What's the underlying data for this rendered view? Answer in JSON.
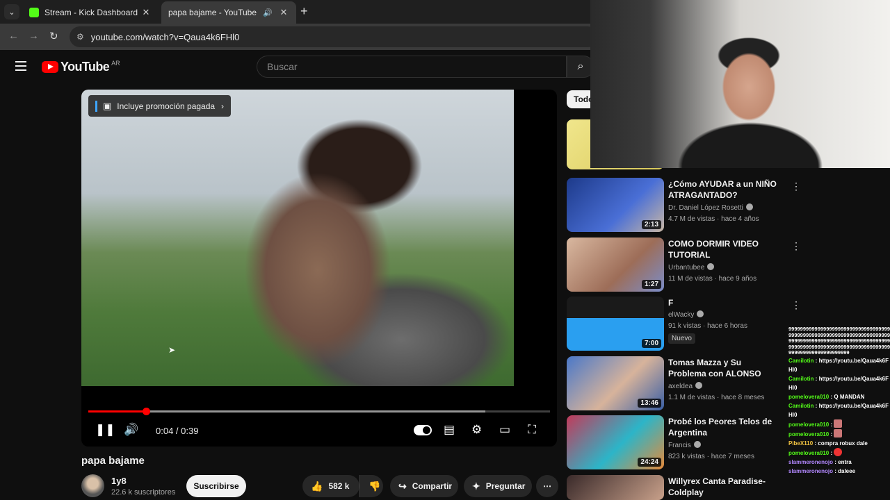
{
  "browser": {
    "tabs": [
      {
        "title": "Stream - Kick Dashboard",
        "close": "✕"
      },
      {
        "title": "papa bajame - YouTube",
        "close": "✕"
      }
    ],
    "new_tab": "+",
    "url": "youtube.com/watch?v=Qaua4k6FHl0"
  },
  "yt": {
    "logo": "YouTube",
    "country": "AR",
    "search_placeholder": "Buscar",
    "chip_all": "Todo"
  },
  "player": {
    "promo": "Incluye promoción pagada",
    "time": "0:04 / 0:39",
    "progress_played_fraction": 0.125,
    "progress_loaded_fraction": 0.86
  },
  "video": {
    "title": "papa bajame",
    "channel": "1y8",
    "subscribers": "22.6 k suscriptores",
    "subscribe": "Suscribirse",
    "likes": "582 k",
    "share": "Compartir",
    "ask": "Preguntar"
  },
  "recommendations": [
    {
      "title": "¿Cómo AYUDAR a un NIÑO ATRAGANTADO?",
      "channel": "Dr. Daniel López Rosetti",
      "meta": "4.7 M de vistas · hace 4 años",
      "duration": "2:13",
      "badge": ""
    },
    {
      "title": "COMO DORMIR VIDEO TUTORIAL",
      "channel": "Urbantubee",
      "meta": "11 M de vistas · hace 9 años",
      "duration": "1:27",
      "badge": ""
    },
    {
      "title": "F",
      "channel": "elWacky",
      "meta": "91 k vistas · hace 6 horas",
      "duration": "7:00",
      "badge": "Nuevo"
    },
    {
      "title": "Tomas Mazza y Su Problema con ALONSO",
      "channel": "axeldea",
      "meta": "1.1 M de vistas · hace 8 meses",
      "duration": "13:46",
      "badge": ""
    },
    {
      "title": "Probé los Peores Telos de Argentina",
      "channel": "Francis",
      "meta": "823 k vistas · hace 7 meses",
      "duration": "24:24",
      "badge": ""
    },
    {
      "title": "Willyrex Canta Paradise-Coldplay",
      "channel": "",
      "meta": "",
      "duration": "",
      "badge": ""
    }
  ],
  "chat": {
    "spam": "99999999999999999999999999999999999999999999999999999999999999999999999999999999999999999999999999999999999999999999999999999999999999999999999999999999999999999",
    "messages": [
      {
        "user": "Camilotin",
        "text": "https://youtu.be/Qaua4k6FHl0"
      },
      {
        "user": "Camilotin",
        "text": "https://youtu.be/Qaua4k6FHl0"
      },
      {
        "user": "pomelovera010",
        "text": "Q MANDAN"
      },
      {
        "user": "Camilotin",
        "text": "https://youtu.be/Qaua4k6FHl0"
      },
      {
        "user": "pomelovera010",
        "text": ""
      },
      {
        "user": "pomelovera010",
        "text": ""
      },
      {
        "user": "PibeX110",
        "text": "compra robux dale"
      },
      {
        "user": "pomelovera010",
        "text": ""
      },
      {
        "user": "slammeronenojo",
        "text": "entra"
      },
      {
        "user": "slammeronenojo",
        "text": "daleee"
      }
    ]
  }
}
